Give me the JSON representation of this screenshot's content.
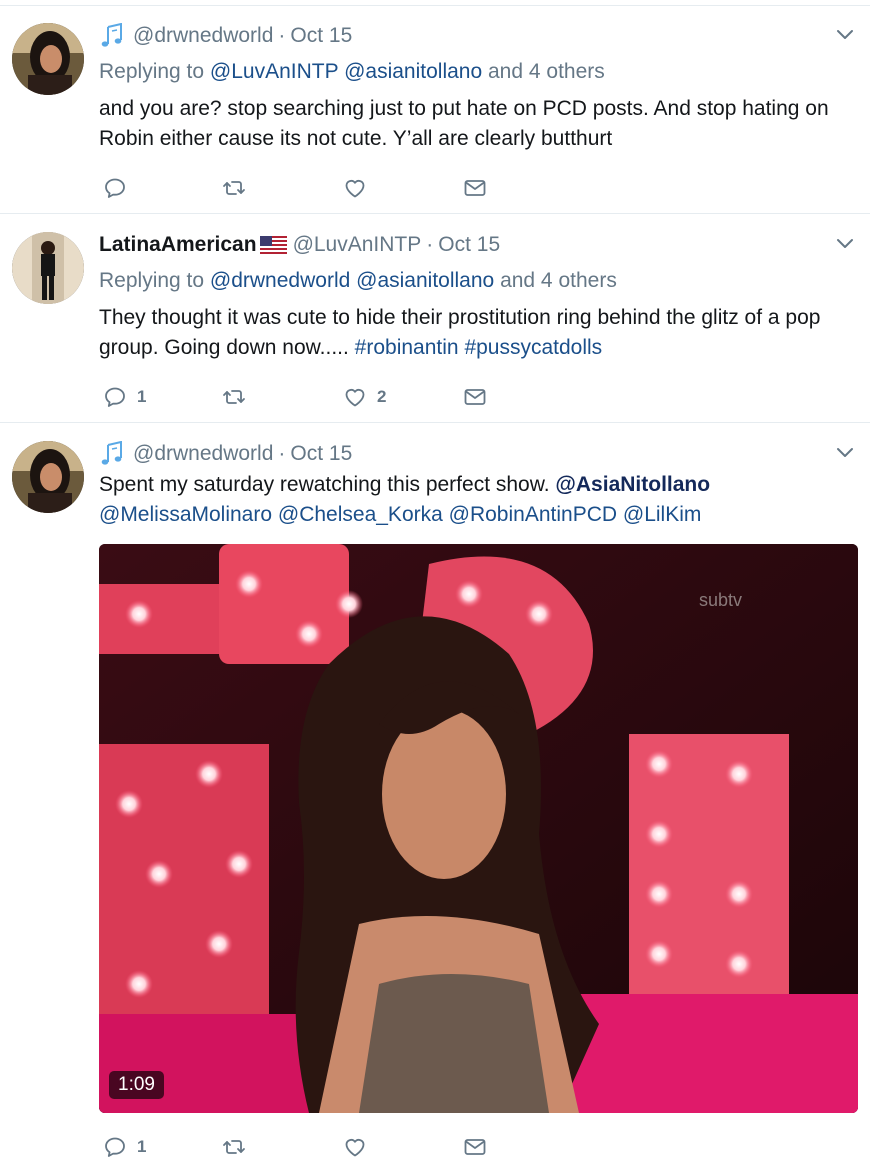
{
  "tweets": [
    {
      "name": "",
      "handle": "@drwnedworld",
      "time": "Oct 15",
      "replying_prefix": "Replying to",
      "replying_to": [
        "@LuvAnINTP",
        "@asianitollano"
      ],
      "replying_suffix": "and 4 others",
      "text": "and you are? stop searching just to put hate on PCD posts. And stop hating on Robin either cause its not cute. Y’all are clearly butthurt",
      "reply_count": "",
      "like_count": ""
    },
    {
      "name": "LatinaAmerican",
      "handle": "@LuvAnINTP",
      "time": "Oct 15",
      "replying_prefix": "Replying to",
      "replying_to": [
        "@drwnedworld",
        "@asianitollano"
      ],
      "replying_suffix": "and 4 others",
      "text_plain": "They thought it was cute to hide their prostitution ring behind the glitz of a pop group. Going down now..... ",
      "hashtags": [
        "#robinantin",
        "#pussycatdolls"
      ],
      "reply_count": "1",
      "like_count": "2"
    },
    {
      "name": "",
      "handle": "@drwnedworld",
      "time": "Oct 15",
      "text_plain": "Spent my saturday rewatching this perfect show. ",
      "mention_bold": "@AsiaNitollano",
      "mentions": [
        "@MelissaMolinaro",
        "@Chelsea_Korka",
        "@RobinAntinPCD",
        "@LilKim"
      ],
      "video_duration": "1:09",
      "video_watermark": "subtv",
      "reply_count": "1",
      "like_count": ""
    }
  ],
  "colors": {
    "text": "#14171a",
    "muted": "#657786",
    "link": "#1b4f8a",
    "divider": "#e6ecf0",
    "music_icon": "#5aa9e6"
  },
  "icons": [
    "music-notes-icon",
    "us-flag-icon",
    "chevron-down-icon",
    "reply-icon",
    "retweet-icon",
    "like-icon",
    "message-icon"
  ]
}
